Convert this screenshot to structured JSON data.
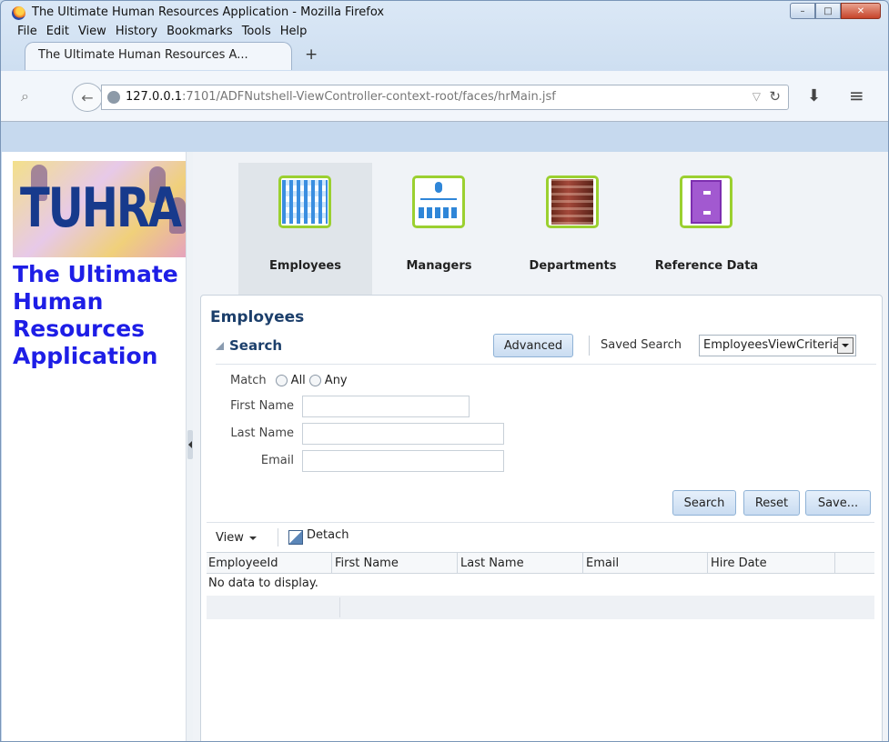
{
  "window": {
    "title": "The Ultimate Human Resources Application - Mozilla Firefox",
    "controls": [
      "–",
      "□",
      "✕"
    ]
  },
  "menubar": [
    "File",
    "Edit",
    "View",
    "History",
    "Bookmarks",
    "Tools",
    "Help"
  ],
  "browser_tab": {
    "title": "The Ultimate Human Resources A...",
    "new_tab": "+"
  },
  "address": {
    "host": "127.0.0.1",
    "rest": ":7101/ADFNutshell-ViewController-context-root/faces/hrMain.jsf"
  },
  "brand": {
    "logo_text": "TUHRA",
    "app_name": "The Ultimate Human Resources Application"
  },
  "nav_tabs": [
    {
      "label": "Employees",
      "icon": "employees-icon",
      "active": true
    },
    {
      "label": "Managers",
      "icon": "managers-icon",
      "active": false
    },
    {
      "label": "Departments",
      "icon": "departments-icon",
      "active": false
    },
    {
      "label": "Reference Data",
      "icon": "reference-data-icon",
      "active": false
    }
  ],
  "panel": {
    "title": "Employees",
    "search": {
      "toggle_label": "Search",
      "advanced_label": "Advanced",
      "saved_search_label": "Saved Search",
      "saved_search_value": "EmployeesViewCriteria",
      "match_label": "Match",
      "match_all": "All",
      "match_any": "Any",
      "fields": [
        {
          "label": "First Name",
          "value": ""
        },
        {
          "label": "Last Name",
          "value": ""
        },
        {
          "label": "Email",
          "value": ""
        }
      ],
      "buttons": {
        "search": "Search",
        "reset": "Reset",
        "save": "Save..."
      }
    },
    "results": {
      "view_label": "View",
      "detach_label": "Detach",
      "columns": [
        "EmployeeId",
        "First Name",
        "Last Name",
        "Email",
        "Hire Date"
      ],
      "empty_message": "No data to display."
    }
  },
  "colors": {
    "app_name": "#1e1ee6",
    "panel_title": "#1c3f6b",
    "nav_icon_border": "#9bd030"
  }
}
